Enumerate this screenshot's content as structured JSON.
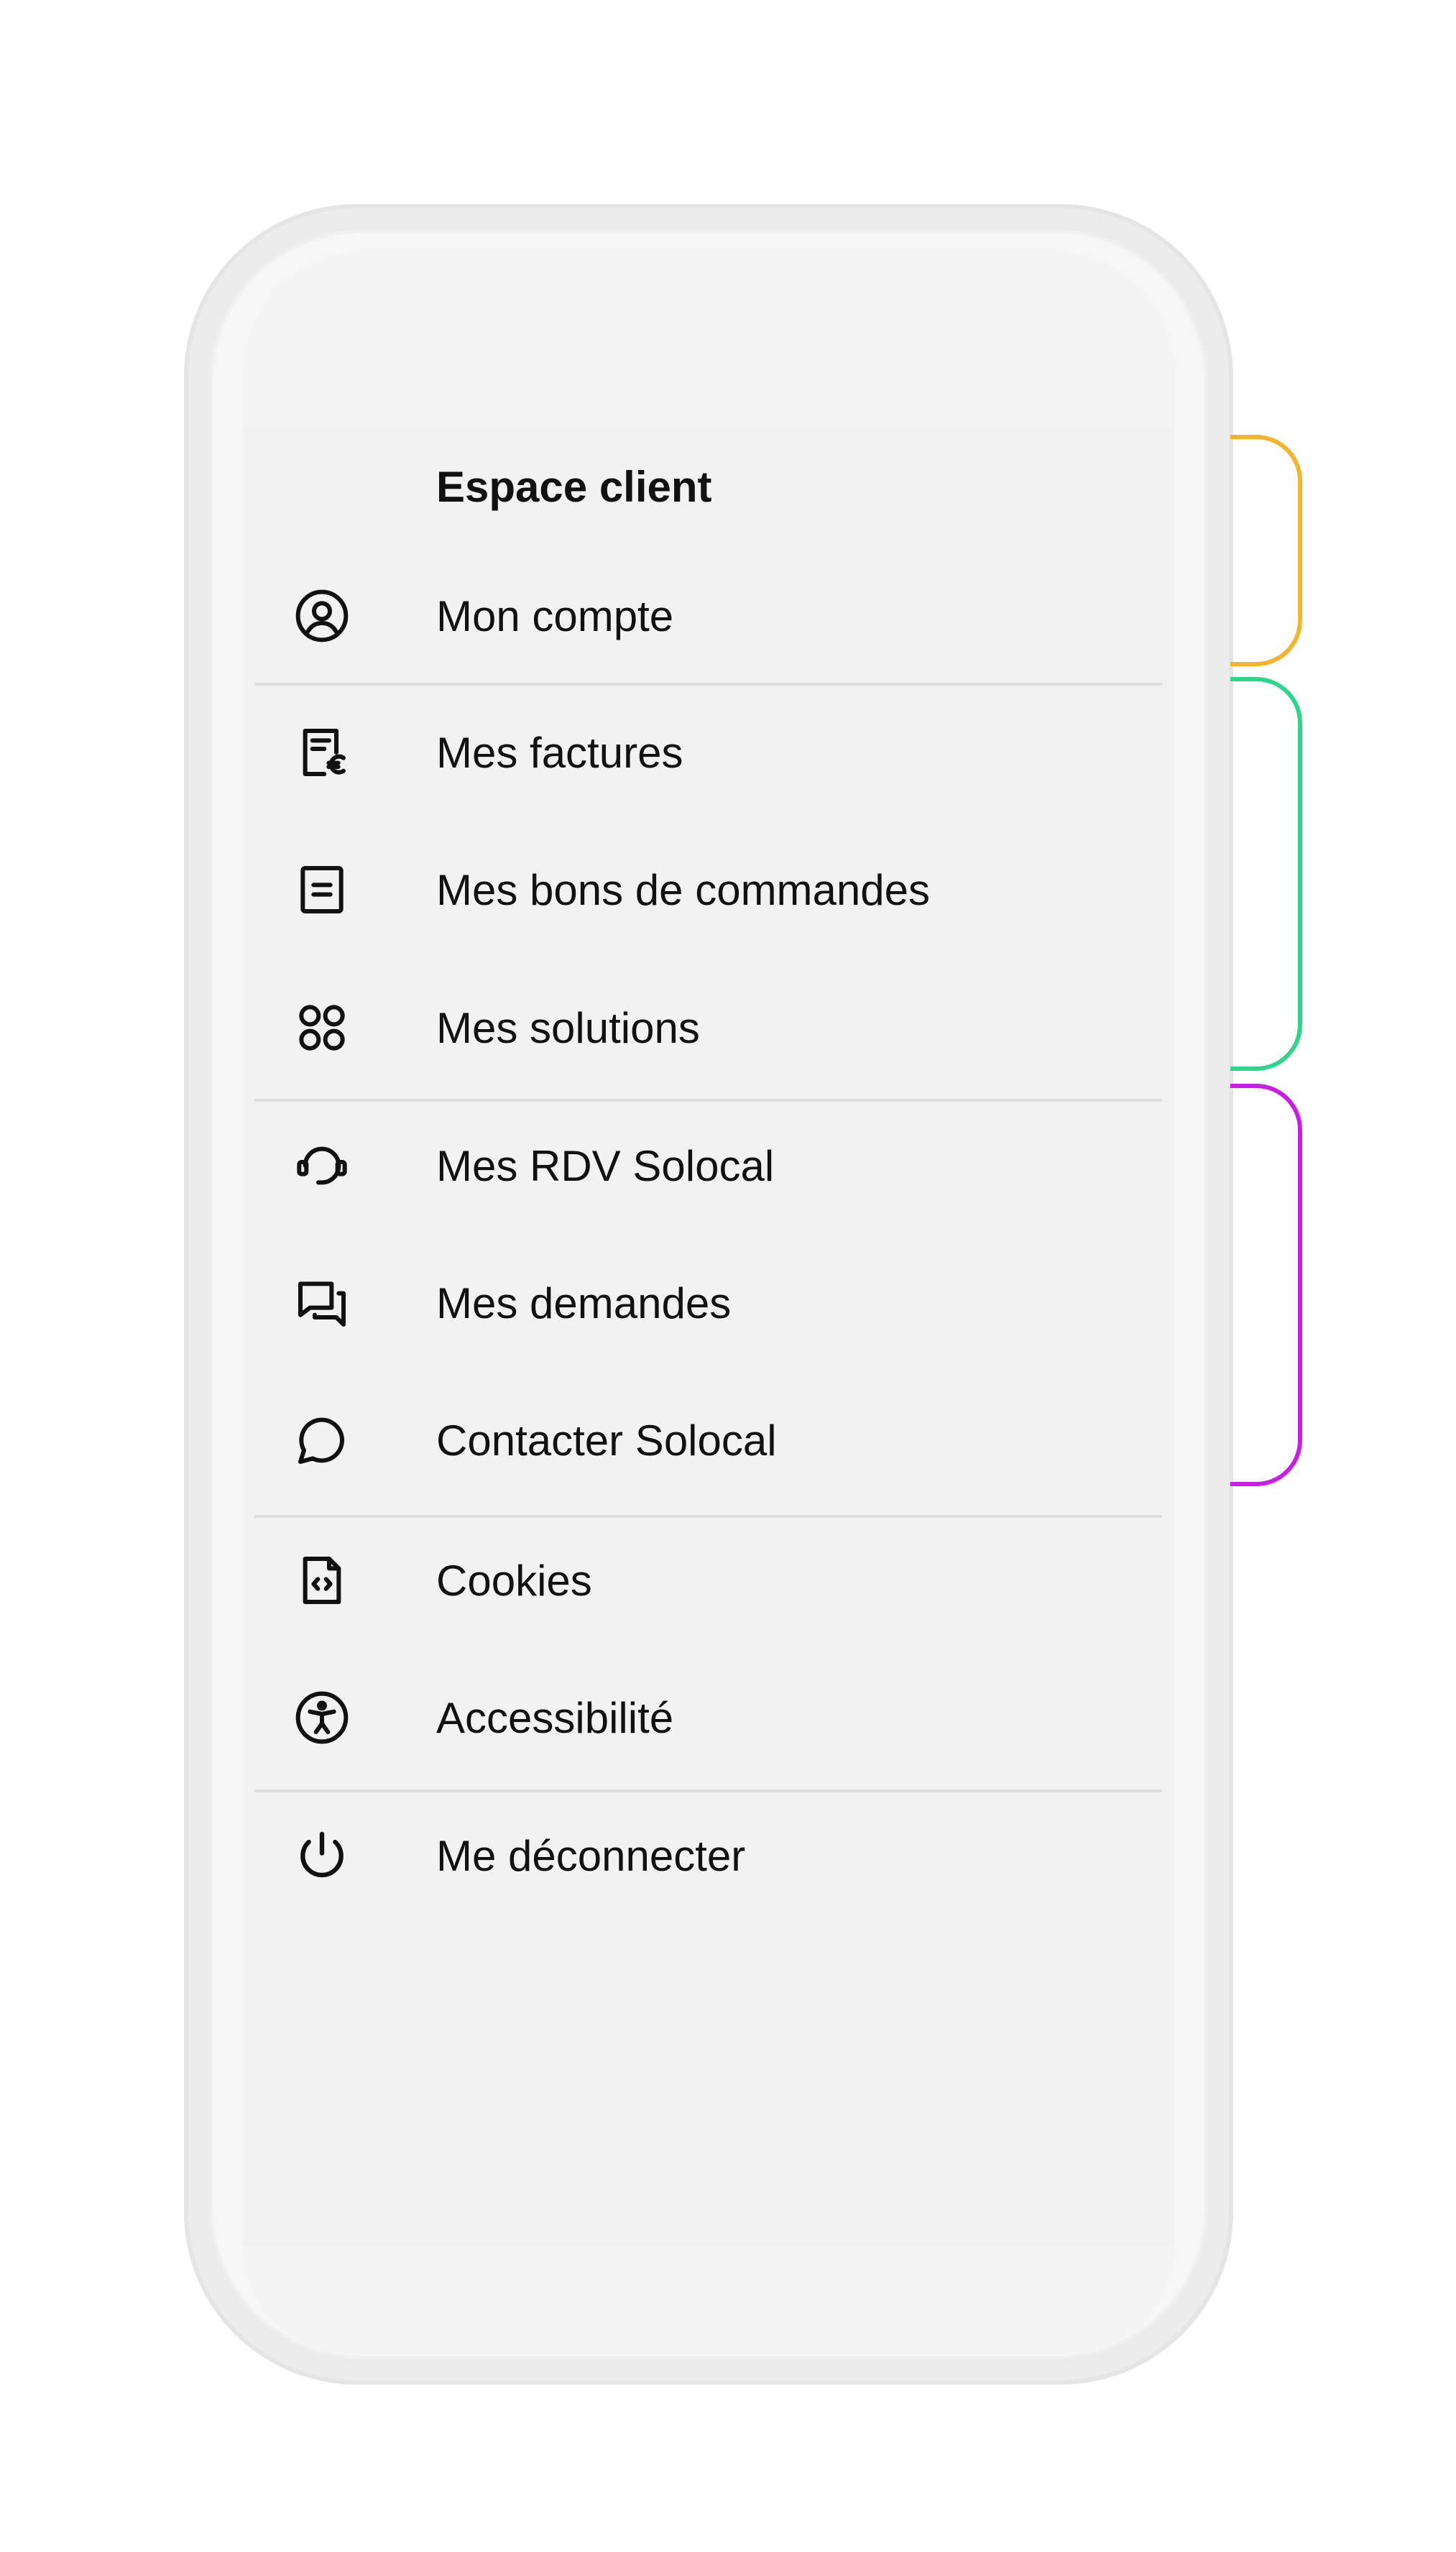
{
  "menu": {
    "section_title": "Espace client",
    "items": [
      {
        "label": "Mon compte",
        "icon": "account-circle-icon"
      },
      {
        "label": "Mes factures",
        "icon": "invoice-euro-icon"
      },
      {
        "label": "Mes bons de commandes",
        "icon": "order-document-icon"
      },
      {
        "label": "Mes solutions",
        "icon": "solutions-grid-icon"
      },
      {
        "label": "Mes RDV Solocal",
        "icon": "headset-icon"
      },
      {
        "label": "Mes demandes",
        "icon": "chat-bubbles-icon"
      },
      {
        "label": "Contacter Solocal",
        "icon": "chat-bubble-icon"
      },
      {
        "label": "Cookies",
        "icon": "code-file-icon"
      },
      {
        "label": "Accessibilité",
        "icon": "accessibility-icon"
      },
      {
        "label": "Me déconnecter",
        "icon": "power-icon"
      }
    ]
  },
  "colors": {
    "bracket_account": "#F7B32B",
    "bracket_documents": "#2DD68A",
    "bracket_support": "#C81EE8",
    "background": "#F2F2F2",
    "text": "#111111"
  }
}
